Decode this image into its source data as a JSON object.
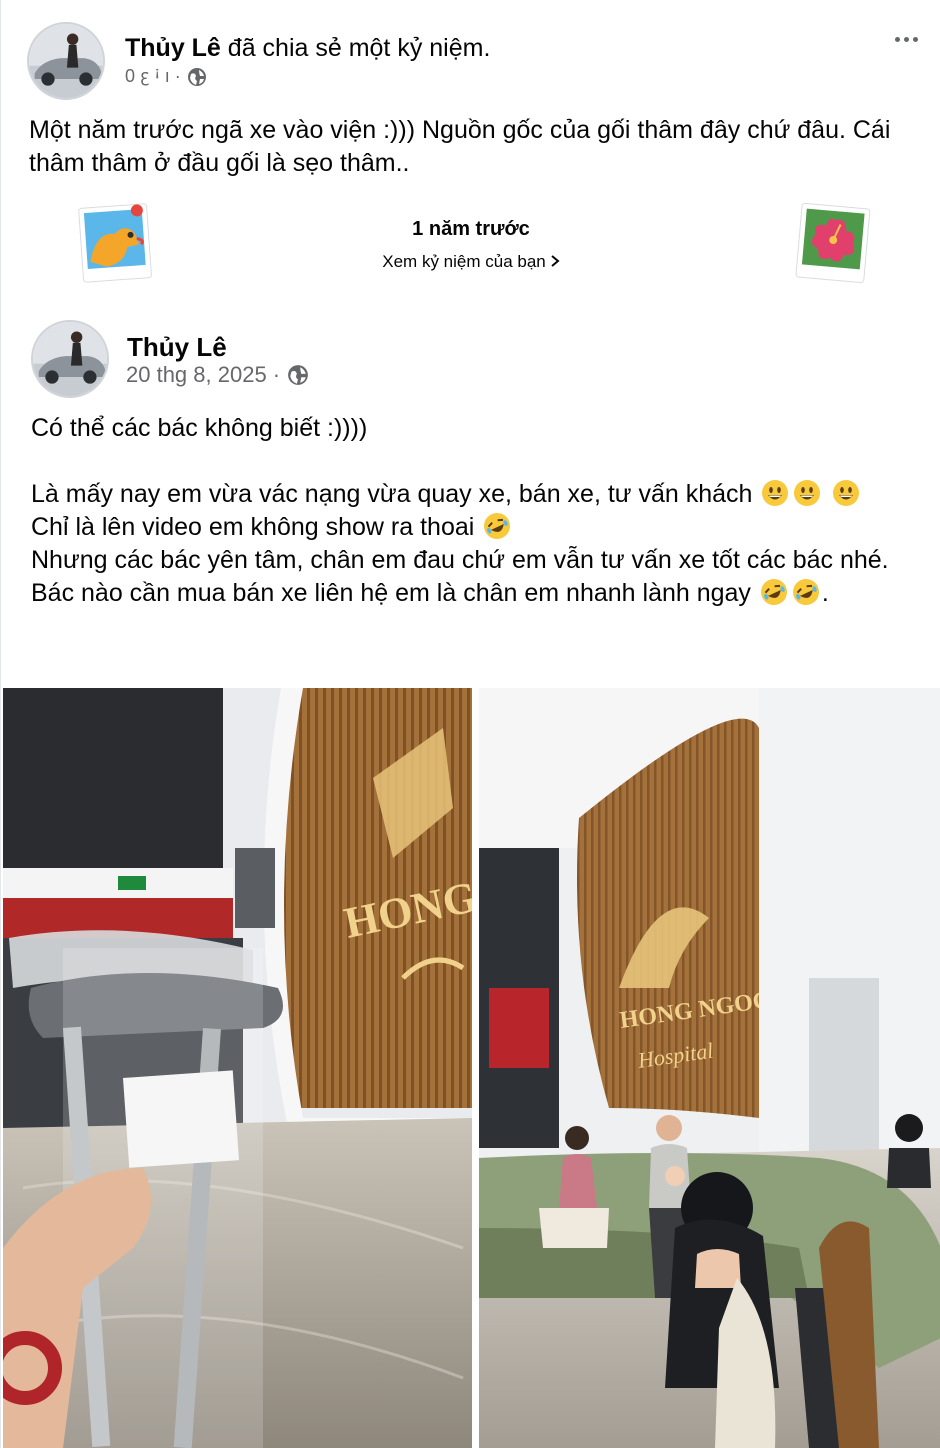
{
  "share": {
    "author": "Thủy Lê",
    "action": " đã chia sẻ một kỷ niệm.",
    "meta_text": "0 ꜫ ꜟ ı ·",
    "caption": "Một năm trước ngã xe vào viện :))) Nguồn gốc của gối thâm đây chứ đâu. Cái thâm thâm ở đầu gối là sẹo thâm.."
  },
  "memory": {
    "title": "1 năm trước",
    "link_label": "Xem kỷ niệm của bạn"
  },
  "post": {
    "author": "Thủy Lê",
    "date": "20 thg 8, 2025 ·",
    "body": {
      "line1": "Có thể các bác không biết :))))",
      "line2a": "Là mấy nay em vừa vác nạng vừa quay xe, bán xe, tư vấn khách",
      "line3": "Chỉ là lên video em không show ra thoai",
      "line4": "Nhưng các bác yên tâm, chân em đau chứ em vẫn tư vấn xe tốt các bác nhé.",
      "line5": "Bác nào cần mua bán xe liên hệ em là chân em nhanh lành ngay",
      "line5_end": "."
    }
  },
  "photos": {
    "left_sign_text": "HONG",
    "right_sign_brand": "HONG NGOC",
    "right_sign_sub": "Hospital"
  },
  "icons": {
    "more": "more-horizontal-icon",
    "globe": "globe-icon",
    "chevron": "chevron-right-icon",
    "emoji_smile": "grinning-face-emoji",
    "emoji_rofl": "rolling-on-floor-laughing-emoji"
  },
  "colors": {
    "text": "#050505",
    "secondary": "#65676b",
    "wood": "#a5713a"
  }
}
